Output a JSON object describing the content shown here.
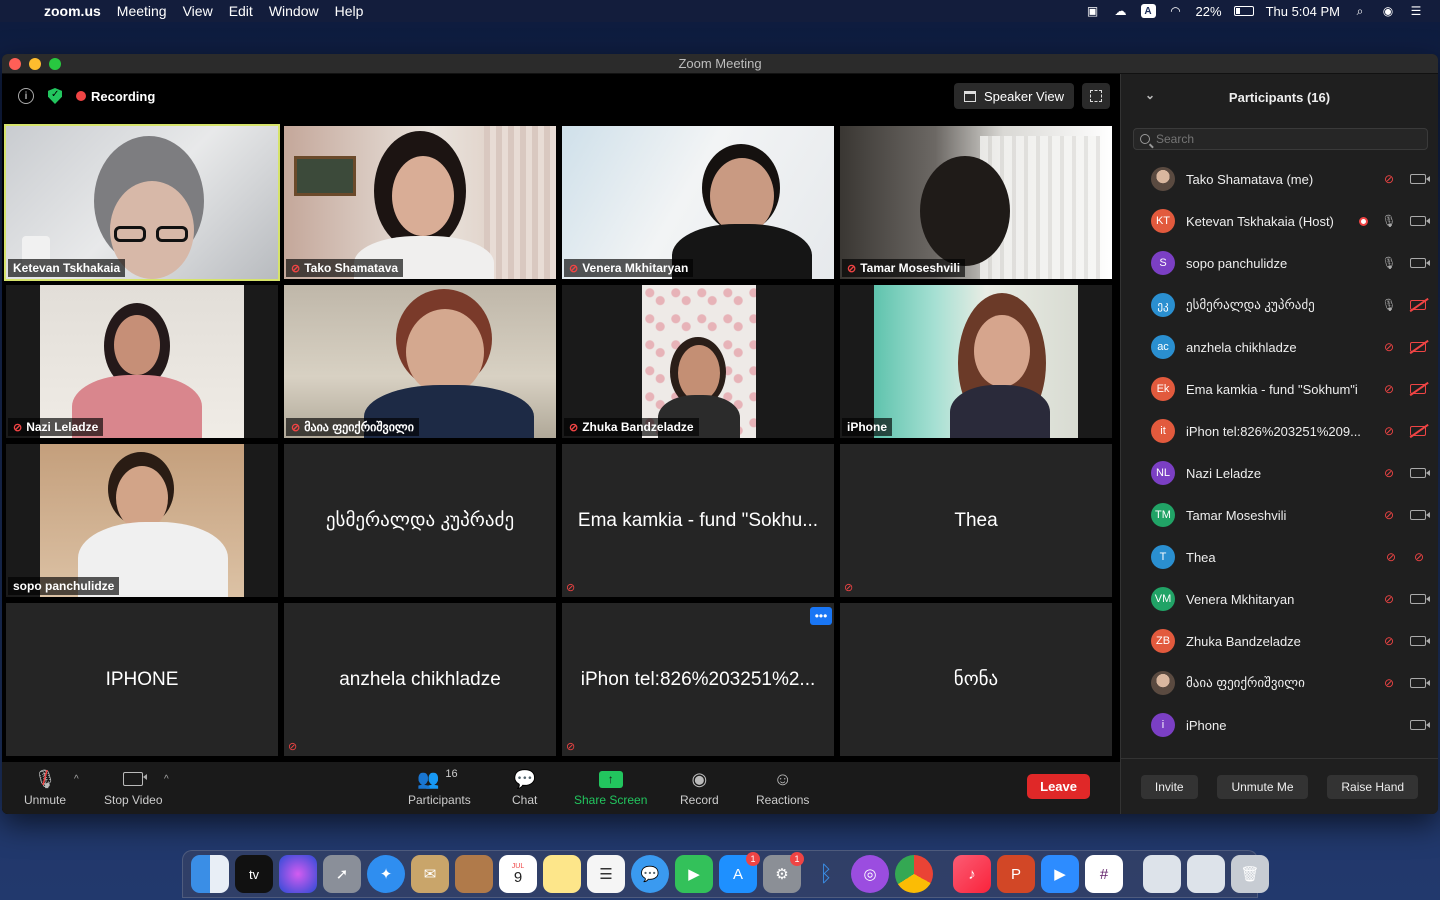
{
  "menubar": {
    "app": "zoom.us",
    "menus": [
      "Meeting",
      "View",
      "Edit",
      "Window",
      "Help"
    ],
    "battery": "22%",
    "clock": "Thu 5:04 PM",
    "input_source": "A"
  },
  "window": {
    "title": "Zoom Meeting",
    "recording_label": "Recording",
    "view_label": "Speaker View"
  },
  "tiles": [
    {
      "name": "Ketevan Tskhakaia",
      "muted": false,
      "video": true
    },
    {
      "name": "Tako Shamatava",
      "muted": true,
      "video": true
    },
    {
      "name": "Venera Mkhitaryan",
      "muted": true,
      "video": true
    },
    {
      "name": "Tamar Moseshvili",
      "muted": true,
      "video": true
    },
    {
      "name": "Nazi Leladze",
      "muted": true,
      "video": true
    },
    {
      "name": "მაია ფეიქრიშვილი",
      "muted": true,
      "video": true
    },
    {
      "name": "Zhuka Bandzeladze",
      "muted": true,
      "video": true
    },
    {
      "name": "iPhone",
      "muted": false,
      "video": true
    },
    {
      "name": "sopo panchulidze",
      "muted": false,
      "video": true
    },
    {
      "name": "ესმერალდა კუპრაძე",
      "muted": false,
      "video": false
    },
    {
      "name": "Ema kamkia - fund \"Sokhu...",
      "muted": true,
      "video": false
    },
    {
      "name": "Thea",
      "muted": true,
      "video": false
    },
    {
      "name": "IPHONE",
      "muted": false,
      "video": false
    },
    {
      "name": "anzhela chikhladze",
      "muted": true,
      "video": false
    },
    {
      "name": "iPhon tel:826%203251%2...",
      "muted": true,
      "video": false
    },
    {
      "name": "ნონა",
      "muted": false,
      "video": false
    }
  ],
  "toolbar": {
    "unmute": "Unmute",
    "stop_video": "Stop Video",
    "participants": "Participants",
    "participants_count": "16",
    "chat": "Chat",
    "share_screen": "Share Screen",
    "record": "Record",
    "reactions": "Reactions",
    "leave": "Leave"
  },
  "panel": {
    "title": "Participants (16)",
    "search_placeholder": "Search",
    "participants": [
      {
        "initials": "",
        "name": "Tako Shamatava (me)",
        "color": "#8a7a6a",
        "mic": "off",
        "cam": "on",
        "photo": true
      },
      {
        "initials": "KT",
        "name": "Ketevan Tskhakaia (Host)",
        "color": "#e25a3d",
        "mic": "on",
        "cam": "on",
        "rec": true
      },
      {
        "initials": "S",
        "name": "sopo panchulidze",
        "color": "#7b3fc4",
        "mic": "on",
        "cam": "on"
      },
      {
        "initials": "ეკ",
        "name": "ესმერალდა კუპრაძე",
        "color": "#2a8fd0",
        "mic": "on",
        "cam": "off"
      },
      {
        "initials": "ac",
        "name": "anzhela chikhladze",
        "color": "#2a8fd0",
        "mic": "off",
        "cam": "off"
      },
      {
        "initials": "Ek",
        "name": "Ema kamkia - fund \"Sokhum\"i",
        "color": "#e25a3d",
        "mic": "off",
        "cam": "off"
      },
      {
        "initials": "it",
        "name": "iPhon tel:826%203251%209...",
        "color": "#e25a3d",
        "mic": "off",
        "cam": "off"
      },
      {
        "initials": "NL",
        "name": "Nazi Leladze",
        "color": "#7b3fc4",
        "mic": "off",
        "cam": "on"
      },
      {
        "initials": "TM",
        "name": "Tamar Moseshvili",
        "color": "#21a366",
        "mic": "off",
        "cam": "on"
      },
      {
        "initials": "T",
        "name": "Thea",
        "color": "#2a8fd0",
        "mic": "off",
        "cam": "none"
      },
      {
        "initials": "VM",
        "name": "Venera Mkhitaryan",
        "color": "#21a366",
        "mic": "off",
        "cam": "on"
      },
      {
        "initials": "ZB",
        "name": "Zhuka Bandzeladze",
        "color": "#e25a3d",
        "mic": "off",
        "cam": "on"
      },
      {
        "initials": "",
        "name": "მაია ფეიქრიშვილი",
        "color": "#8a7a6a",
        "mic": "off",
        "cam": "on",
        "photo": true
      },
      {
        "initials": "i",
        "name": "iPhone",
        "color": "#7b3fc4",
        "mic": "none",
        "cam": "on"
      }
    ],
    "invite": "Invite",
    "unmute_me": "Unmute Me",
    "raise_hand": "Raise Hand"
  },
  "dock": {
    "calendar_month": "JUL",
    "calendar_day": "9",
    "appstore_badge": "1",
    "settings_badge": "1"
  }
}
